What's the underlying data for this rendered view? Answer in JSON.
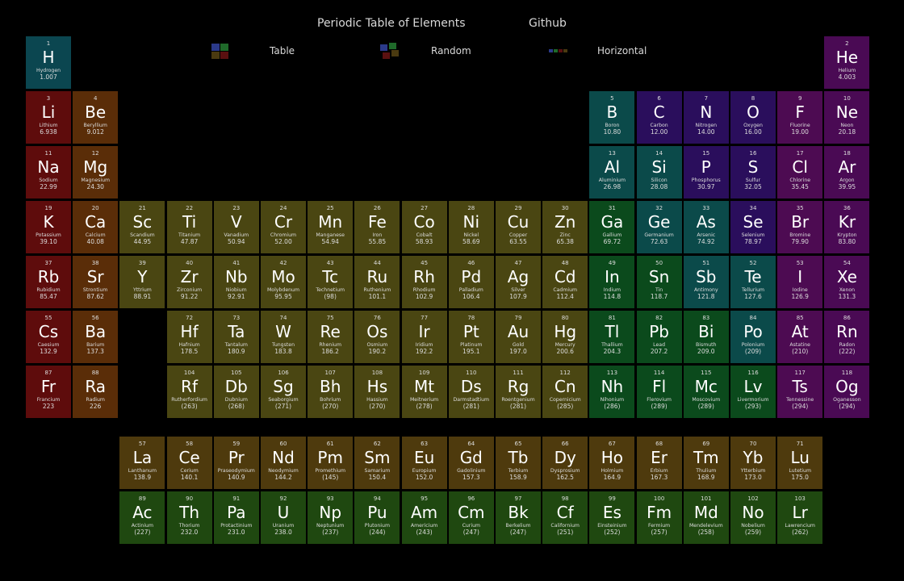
{
  "header": {
    "title": "Periodic Table of Elements",
    "github": "Github"
  },
  "nav": {
    "table": "Table",
    "random": "Random",
    "horizontal": "Horizontal"
  },
  "colors": {
    "alkali": "#5e0c0c",
    "alkaline_earth": "#5a2d08",
    "transition": "#4a4612",
    "post_transition": "#0b4a1c",
    "metalloid": "#0b4a4a",
    "nonmetal": "#2a0e5c",
    "halogen": "#4d0b52",
    "noble_gas": "#4a0a54",
    "lanthanide": "#4e3a0d",
    "actinide": "#1f4810",
    "hydrogen": "#0b4650"
  },
  "elements": [
    [
      "1",
      "H",
      "Hydrogen",
      "1.007",
      "hydrogen"
    ],
    [
      "2",
      "He",
      "Helium",
      "4.003",
      "noble_gas"
    ],
    [
      "3",
      "Li",
      "Lithium",
      "6.938",
      "alkali"
    ],
    [
      "4",
      "Be",
      "Beryllium",
      "9.012",
      "alkaline_earth"
    ],
    [
      "5",
      "B",
      "Boron",
      "10.80",
      "metalloid"
    ],
    [
      "6",
      "C",
      "Carbon",
      "12.00",
      "nonmetal"
    ],
    [
      "7",
      "N",
      "Nitrogen",
      "14.00",
      "nonmetal"
    ],
    [
      "8",
      "O",
      "Oxygen",
      "16.00",
      "nonmetal"
    ],
    [
      "9",
      "F",
      "Fluorine",
      "19.00",
      "halogen"
    ],
    [
      "10",
      "Ne",
      "Neon",
      "20.18",
      "noble_gas"
    ],
    [
      "11",
      "Na",
      "Sodium",
      "22.99",
      "alkali"
    ],
    [
      "12",
      "Mg",
      "Magnesium",
      "24.30",
      "alkaline_earth"
    ],
    [
      "13",
      "Al",
      "Aluminium",
      "26.98",
      "metalloid"
    ],
    [
      "14",
      "Si",
      "Silicon",
      "28.08",
      "metalloid"
    ],
    [
      "15",
      "P",
      "Phosphorus",
      "30.97",
      "nonmetal"
    ],
    [
      "16",
      "S",
      "Sulfur",
      "32.05",
      "nonmetal"
    ],
    [
      "17",
      "Cl",
      "Chlorine",
      "35.45",
      "halogen"
    ],
    [
      "18",
      "Ar",
      "Argon",
      "39.95",
      "noble_gas"
    ],
    [
      "19",
      "K",
      "Potassium",
      "39.10",
      "alkali"
    ],
    [
      "20",
      "Ca",
      "Calcium",
      "40.08",
      "alkaline_earth"
    ],
    [
      "21",
      "Sc",
      "Scandium",
      "44.95",
      "transition"
    ],
    [
      "22",
      "Ti",
      "Titanium",
      "47.87",
      "transition"
    ],
    [
      "23",
      "V",
      "Vanadium",
      "50.94",
      "transition"
    ],
    [
      "24",
      "Cr",
      "Chromium",
      "52.00",
      "transition"
    ],
    [
      "25",
      "Mn",
      "Manganese",
      "54.94",
      "transition"
    ],
    [
      "26",
      "Fe",
      "Iron",
      "55.85",
      "transition"
    ],
    [
      "27",
      "Co",
      "Cobalt",
      "58.93",
      "transition"
    ],
    [
      "28",
      "Ni",
      "Nickel",
      "58.69",
      "transition"
    ],
    [
      "29",
      "Cu",
      "Copper",
      "63.55",
      "transition"
    ],
    [
      "30",
      "Zn",
      "Zinc",
      "65.38",
      "transition"
    ],
    [
      "31",
      "Ga",
      "Gallium",
      "69.72",
      "post_transition"
    ],
    [
      "32",
      "Ge",
      "Germanium",
      "72.63",
      "metalloid"
    ],
    [
      "33",
      "As",
      "Arsenic",
      "74.92",
      "metalloid"
    ],
    [
      "34",
      "Se",
      "Selenium",
      "78.97",
      "nonmetal"
    ],
    [
      "35",
      "Br",
      "Bromine",
      "79.90",
      "halogen"
    ],
    [
      "36",
      "Kr",
      "Krypton",
      "83.80",
      "noble_gas"
    ],
    [
      "37",
      "Rb",
      "Rubidium",
      "85.47",
      "alkali"
    ],
    [
      "38",
      "Sr",
      "Strontium",
      "87.62",
      "alkaline_earth"
    ],
    [
      "39",
      "Y",
      "Yttrium",
      "88.91",
      "transition"
    ],
    [
      "40",
      "Zr",
      "Zirconium",
      "91.22",
      "transition"
    ],
    [
      "41",
      "Nb",
      "Niobium",
      "92.91",
      "transition"
    ],
    [
      "42",
      "Mo",
      "Molybdenum",
      "95.95",
      "transition"
    ],
    [
      "43",
      "Tc",
      "Technetium",
      "(98)",
      "transition"
    ],
    [
      "44",
      "Ru",
      "Ruthenium",
      "101.1",
      "transition"
    ],
    [
      "45",
      "Rh",
      "Rhodium",
      "102.9",
      "transition"
    ],
    [
      "46",
      "Pd",
      "Palladium",
      "106.4",
      "transition"
    ],
    [
      "47",
      "Ag",
      "Silver",
      "107.9",
      "transition"
    ],
    [
      "48",
      "Cd",
      "Cadmium",
      "112.4",
      "transition"
    ],
    [
      "49",
      "In",
      "Indium",
      "114.8",
      "post_transition"
    ],
    [
      "50",
      "Sn",
      "Tin",
      "118.7",
      "post_transition"
    ],
    [
      "51",
      "Sb",
      "Antimony",
      "121.8",
      "metalloid"
    ],
    [
      "52",
      "Te",
      "Tellurium",
      "127.6",
      "metalloid"
    ],
    [
      "53",
      "I",
      "Iodine",
      "126.9",
      "halogen"
    ],
    [
      "54",
      "Xe",
      "Xenon",
      "131.3",
      "noble_gas"
    ],
    [
      "55",
      "Cs",
      "Caesium",
      "132.9",
      "alkali"
    ],
    [
      "56",
      "Ba",
      "Barium",
      "137.3",
      "alkaline_earth"
    ],
    [
      "72",
      "Hf",
      "Hafnium",
      "178.5",
      "transition"
    ],
    [
      "73",
      "Ta",
      "Tantalum",
      "180.9",
      "transition"
    ],
    [
      "74",
      "W",
      "Tungsten",
      "183.8",
      "transition"
    ],
    [
      "75",
      "Re",
      "Rhenium",
      "186.2",
      "transition"
    ],
    [
      "76",
      "Os",
      "Osmium",
      "190.2",
      "transition"
    ],
    [
      "77",
      "Ir",
      "Iridium",
      "192.2",
      "transition"
    ],
    [
      "78",
      "Pt",
      "Platinum",
      "195.1",
      "transition"
    ],
    [
      "79",
      "Au",
      "Gold",
      "197.0",
      "transition"
    ],
    [
      "80",
      "Hg",
      "Mercury",
      "200.6",
      "transition"
    ],
    [
      "81",
      "Tl",
      "Thallium",
      "204.3",
      "post_transition"
    ],
    [
      "82",
      "Pb",
      "Lead",
      "207.2",
      "post_transition"
    ],
    [
      "83",
      "Bi",
      "Bismuth",
      "209.0",
      "post_transition"
    ],
    [
      "84",
      "Po",
      "Polonium",
      "(209)",
      "metalloid"
    ],
    [
      "85",
      "At",
      "Astatine",
      "(210)",
      "halogen"
    ],
    [
      "86",
      "Rn",
      "Radon",
      "(222)",
      "noble_gas"
    ],
    [
      "87",
      "Fr",
      "Francium",
      "223",
      "alkali"
    ],
    [
      "88",
      "Ra",
      "Radium",
      "226",
      "alkaline_earth"
    ],
    [
      "104",
      "Rf",
      "Rutherfordium",
      "(263)",
      "transition"
    ],
    [
      "105",
      "Db",
      "Dubnium",
      "(268)",
      "transition"
    ],
    [
      "106",
      "Sg",
      "Seaborgium",
      "(271)",
      "transition"
    ],
    [
      "107",
      "Bh",
      "Bohrium",
      "(270)",
      "transition"
    ],
    [
      "108",
      "Hs",
      "Hassium",
      "(270)",
      "transition"
    ],
    [
      "109",
      "Mt",
      "Meitnerium",
      "(278)",
      "transition"
    ],
    [
      "110",
      "Ds",
      "Darmstadtium",
      "(281)",
      "transition"
    ],
    [
      "111",
      "Rg",
      "Roentgenium",
      "(281)",
      "transition"
    ],
    [
      "112",
      "Cn",
      "Copernicium",
      "(285)",
      "transition"
    ],
    [
      "113",
      "Nh",
      "Nihonium",
      "(286)",
      "post_transition"
    ],
    [
      "114",
      "Fl",
      "Flerovium",
      "(289)",
      "post_transition"
    ],
    [
      "115",
      "Mc",
      "Moscovium",
      "(289)",
      "post_transition"
    ],
    [
      "116",
      "Lv",
      "Livermorium",
      "(293)",
      "post_transition"
    ],
    [
      "117",
      "Ts",
      "Tennessine",
      "(294)",
      "halogen"
    ],
    [
      "118",
      "Og",
      "Oganesson",
      "(294)",
      "noble_gas"
    ],
    [
      "57",
      "La",
      "Lanthanum",
      "138.9",
      "lanthanide"
    ],
    [
      "58",
      "Ce",
      "Cerium",
      "140.1",
      "lanthanide"
    ],
    [
      "59",
      "Pr",
      "Praseodymium",
      "140.9",
      "lanthanide"
    ],
    [
      "60",
      "Nd",
      "Neodymium",
      "144.2",
      "lanthanide"
    ],
    [
      "61",
      "Pm",
      "Promethium",
      "(145)",
      "lanthanide"
    ],
    [
      "62",
      "Sm",
      "Samarium",
      "150.4",
      "lanthanide"
    ],
    [
      "63",
      "Eu",
      "Europium",
      "152.0",
      "lanthanide"
    ],
    [
      "64",
      "Gd",
      "Gadolinium",
      "157.3",
      "lanthanide"
    ],
    [
      "65",
      "Tb",
      "Terbium",
      "158.9",
      "lanthanide"
    ],
    [
      "66",
      "Dy",
      "Dysprosium",
      "162.5",
      "lanthanide"
    ],
    [
      "67",
      "Ho",
      "Holmium",
      "164.9",
      "lanthanide"
    ],
    [
      "68",
      "Er",
      "Erbium",
      "167.3",
      "lanthanide"
    ],
    [
      "69",
      "Tm",
      "Thulium",
      "168.9",
      "lanthanide"
    ],
    [
      "70",
      "Yb",
      "Ytterbium",
      "173.0",
      "lanthanide"
    ],
    [
      "71",
      "Lu",
      "Lutetium",
      "175.0",
      "lanthanide"
    ],
    [
      "89",
      "Ac",
      "Actinium",
      "(227)",
      "actinide"
    ],
    [
      "90",
      "Th",
      "Thorium",
      "232.0",
      "actinide"
    ],
    [
      "91",
      "Pa",
      "Protactinium",
      "231.0",
      "actinide"
    ],
    [
      "92",
      "U",
      "Uranium",
      "238.0",
      "actinide"
    ],
    [
      "93",
      "Np",
      "Neptunium",
      "(237)",
      "actinide"
    ],
    [
      "94",
      "Pu",
      "Plutonium",
      "(244)",
      "actinide"
    ],
    [
      "95",
      "Am",
      "Americium",
      "(243)",
      "actinide"
    ],
    [
      "96",
      "Cm",
      "Curium",
      "(247)",
      "actinide"
    ],
    [
      "97",
      "Bk",
      "Berkelium",
      "(247)",
      "actinide"
    ],
    [
      "98",
      "Cf",
      "Californium",
      "(251)",
      "actinide"
    ],
    [
      "99",
      "Es",
      "Einsteinium",
      "(252)",
      "actinide"
    ],
    [
      "100",
      "Fm",
      "Fermium",
      "(257)",
      "actinide"
    ],
    [
      "101",
      "Md",
      "Mendelevium",
      "(258)",
      "actinide"
    ],
    [
      "102",
      "No",
      "Nobelium",
      "(259)",
      "actinide"
    ],
    [
      "103",
      "Lr",
      "Lawrencium",
      "(262)",
      "actinide"
    ]
  ]
}
